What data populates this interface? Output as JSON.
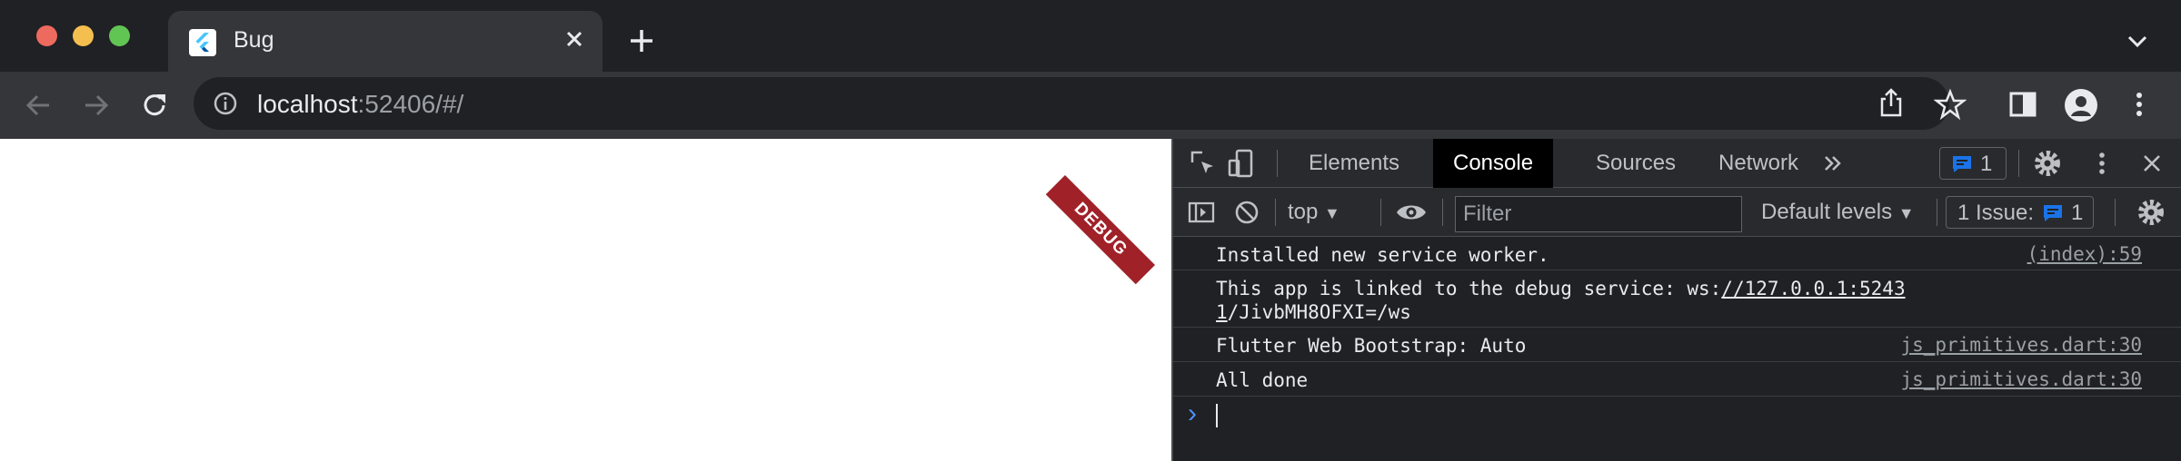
{
  "browser": {
    "tab_title": "Bug",
    "url_host": "localhost",
    "url_rest": ":52406/#/"
  },
  "page": {
    "debug_banner": "DEBUG"
  },
  "devtools": {
    "tabs": [
      "Elements",
      "Console",
      "Sources",
      "Network"
    ],
    "active_tab": "Console",
    "messages_badge": "1",
    "context": "top",
    "filter_placeholder": "Filter",
    "levels": "Default levels",
    "issues_label": "1 Issue:",
    "issues_count": "1",
    "console": [
      {
        "text": "Installed new service worker.",
        "source": "(index):59"
      },
      {
        "text_prefix": "This app is linked to the debug service: ws:",
        "text_link1": "//127.0.0.1:5243",
        "text_link2": "1",
        "text_suffix": "/JivbMH8OFXI=/ws",
        "source": ""
      },
      {
        "text": "Flutter Web Bootstrap: Auto",
        "source": "js_primitives.dart:30"
      },
      {
        "text": "All done",
        "source": "js_primitives.dart:30"
      }
    ],
    "prompt": "›"
  },
  "colors": {
    "accent": "#1a73e8",
    "debug_ribbon": "#a02128"
  }
}
